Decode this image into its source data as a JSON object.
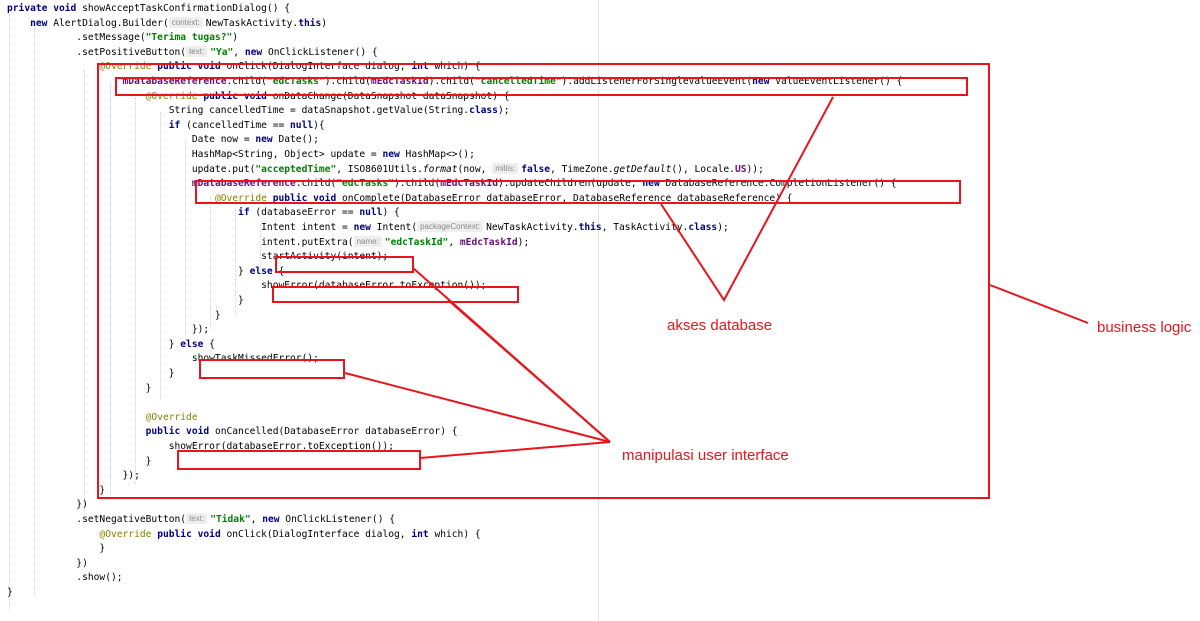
{
  "code_lines": [
    [
      {
        "t": "private void ",
        "c": "kw"
      },
      {
        "t": "showAcceptTaskConfirmationDialog() {"
      }
    ],
    [
      {
        "t": "    "
      },
      {
        "t": "new ",
        "c": "kw"
      },
      {
        "t": "AlertDialog.Builder("
      },
      {
        "t": "context:",
        "c": "hint"
      },
      {
        "t": "NewTaskActivity."
      },
      {
        "t": "this",
        "c": "kw"
      },
      {
        "t": ")"
      }
    ],
    [
      {
        "t": "            .setMessage("
      },
      {
        "t": "\"Terima tugas?\"",
        "c": "str"
      },
      {
        "t": ")"
      }
    ],
    [
      {
        "t": "            .setPositiveButton("
      },
      {
        "t": "text:",
        "c": "hint"
      },
      {
        "t": "\"Ya\"",
        "c": "str"
      },
      {
        "t": ", "
      },
      {
        "t": "new ",
        "c": "kw"
      },
      {
        "t": "OnClickListener() {"
      }
    ],
    [
      {
        "t": "                "
      },
      {
        "t": "@Override ",
        "c": "ann"
      },
      {
        "t": "public void ",
        "c": "kw"
      },
      {
        "t": "onClick(DialogInterface dialog, "
      },
      {
        "t": "int ",
        "c": "kw"
      },
      {
        "t": "which) {"
      }
    ],
    [
      {
        "t": "                    "
      },
      {
        "t": "mDatabaseReference",
        "c": "fld"
      },
      {
        "t": ".child("
      },
      {
        "t": "\"edcTasks\"",
        "c": "str"
      },
      {
        "t": ").child("
      },
      {
        "t": "mEdcTaskId",
        "c": "fld"
      },
      {
        "t": ").child("
      },
      {
        "t": "\"cancelledTime\"",
        "c": "str"
      },
      {
        "t": ").addListenerForSingleValueEvent("
      },
      {
        "t": "new ",
        "c": "kw"
      },
      {
        "t": "ValueEventListener() {"
      }
    ],
    [
      {
        "t": "                        "
      },
      {
        "t": "@Override ",
        "c": "ann"
      },
      {
        "t": "public void ",
        "c": "kw"
      },
      {
        "t": "onDataChange(DataSnapshot dataSnapshot) {"
      }
    ],
    [
      {
        "t": "                            String cancelledTime = dataSnapshot.getValue(String."
      },
      {
        "t": "class",
        "c": "kw"
      },
      {
        "t": ");"
      }
    ],
    [
      {
        "t": "                            "
      },
      {
        "t": "if ",
        "c": "kw"
      },
      {
        "t": "(cancelledTime == "
      },
      {
        "t": "null",
        "c": "kw"
      },
      {
        "t": "){"
      }
    ],
    [
      {
        "t": "                                Date now = "
      },
      {
        "t": "new ",
        "c": "kw"
      },
      {
        "t": "Date();"
      }
    ],
    [
      {
        "t": "                                HashMap<String, Object> update = "
      },
      {
        "t": "new ",
        "c": "kw"
      },
      {
        "t": "HashMap<>();"
      }
    ],
    [
      {
        "t": "                                update.put("
      },
      {
        "t": "\"acceptedTime\"",
        "c": "str"
      },
      {
        "t": ", ISO8601Utils."
      },
      {
        "t": "format",
        "c": "itl"
      },
      {
        "t": "(now, "
      },
      {
        "t": "millis:",
        "c": "hint"
      },
      {
        "t": "false",
        "c": "kw"
      },
      {
        "t": ", TimeZone."
      },
      {
        "t": "getDefault",
        "c": "itl"
      },
      {
        "t": "(), Locale."
      },
      {
        "t": "US",
        "c": "fld"
      },
      {
        "t": "));"
      }
    ],
    [
      {
        "t": "                                "
      },
      {
        "t": "mDatabaseReference",
        "c": "fld"
      },
      {
        "t": ".child("
      },
      {
        "t": "\"edcTasks\"",
        "c": "str"
      },
      {
        "t": ").child("
      },
      {
        "t": "mEdcTaskId",
        "c": "fld"
      },
      {
        "t": ").updateChildren(update, "
      },
      {
        "t": "new ",
        "c": "kw"
      },
      {
        "t": "DatabaseReference.CompletionListener() {"
      }
    ],
    [
      {
        "t": "                                    "
      },
      {
        "t": "@Override ",
        "c": "ann"
      },
      {
        "t": "public void ",
        "c": "kw"
      },
      {
        "t": "onComplete(DatabaseError databaseError, DatabaseReference databaseReference) {"
      }
    ],
    [
      {
        "t": "                                        "
      },
      {
        "t": "if ",
        "c": "kw"
      },
      {
        "t": "(databaseError == "
      },
      {
        "t": "null",
        "c": "kw"
      },
      {
        "t": ") {"
      }
    ],
    [
      {
        "t": "                                            Intent intent = "
      },
      {
        "t": "new ",
        "c": "kw"
      },
      {
        "t": "Intent("
      },
      {
        "t": "packageContext:",
        "c": "hint"
      },
      {
        "t": "NewTaskActivity."
      },
      {
        "t": "this",
        "c": "kw"
      },
      {
        "t": ", TaskActivity."
      },
      {
        "t": "class",
        "c": "kw"
      },
      {
        "t": ");"
      }
    ],
    [
      {
        "t": "                                            intent.putExtra("
      },
      {
        "t": "name:",
        "c": "hint"
      },
      {
        "t": "\"edcTaskId\"",
        "c": "str"
      },
      {
        "t": ", "
      },
      {
        "t": "mEdcTaskId",
        "c": "fld"
      },
      {
        "t": ");"
      }
    ],
    [
      {
        "t": "                                            startActivity(intent);"
      }
    ],
    [
      {
        "t": "                                        } "
      },
      {
        "t": "else ",
        "c": "kw"
      },
      {
        "t": "{"
      }
    ],
    [
      {
        "t": "                                            showError(databaseError.toException());"
      }
    ],
    [
      {
        "t": "                                        }"
      }
    ],
    [
      {
        "t": "                                    }"
      }
    ],
    [
      {
        "t": "                                });"
      }
    ],
    [
      {
        "t": "                            } "
      },
      {
        "t": "else ",
        "c": "kw"
      },
      {
        "t": "{"
      }
    ],
    [
      {
        "t": "                                showTaskMissedError();"
      }
    ],
    [
      {
        "t": "                            }"
      }
    ],
    [
      {
        "t": "                        }"
      }
    ],
    [
      {
        "t": ""
      }
    ],
    [
      {
        "t": "                        "
      },
      {
        "t": "@Override",
        "c": "ann"
      }
    ],
    [
      {
        "t": "                        "
      },
      {
        "t": "public void ",
        "c": "kw"
      },
      {
        "t": "onCancelled(DatabaseError databaseError) {"
      }
    ],
    [
      {
        "t": "                            showError(databaseError.toException());"
      }
    ],
    [
      {
        "t": "                        }"
      }
    ],
    [
      {
        "t": "                    });"
      }
    ],
    [
      {
        "t": "                }"
      }
    ],
    [
      {
        "t": "            })"
      }
    ],
    [
      {
        "t": "            .setNegativeButton("
      },
      {
        "t": "text:",
        "c": "hint"
      },
      {
        "t": "\"Tidak\"",
        "c": "str"
      },
      {
        "t": ", "
      },
      {
        "t": "new ",
        "c": "kw"
      },
      {
        "t": "OnClickListener() {"
      }
    ],
    [
      {
        "t": "                "
      },
      {
        "t": "@Override ",
        "c": "ann"
      },
      {
        "t": "public void ",
        "c": "kw"
      },
      {
        "t": "onClick(DialogInterface dialog, "
      },
      {
        "t": "int ",
        "c": "kw"
      },
      {
        "t": "which) {"
      }
    ],
    [
      {
        "t": "                }"
      }
    ],
    [
      {
        "t": "            })"
      }
    ],
    [
      {
        "t": "            .show();"
      }
    ],
    [
      {
        "t": "}"
      }
    ]
  ],
  "annotations": {
    "database_label": "akses database",
    "ui_label": "manipulasi user interface",
    "business_label": "business logic"
  },
  "colors": {
    "annotation_red": "#e8151c",
    "keyword": "#000080",
    "string": "#008000",
    "annotation": "#808000",
    "field": "#660e7a",
    "hint_bg": "#eeeeee"
  }
}
